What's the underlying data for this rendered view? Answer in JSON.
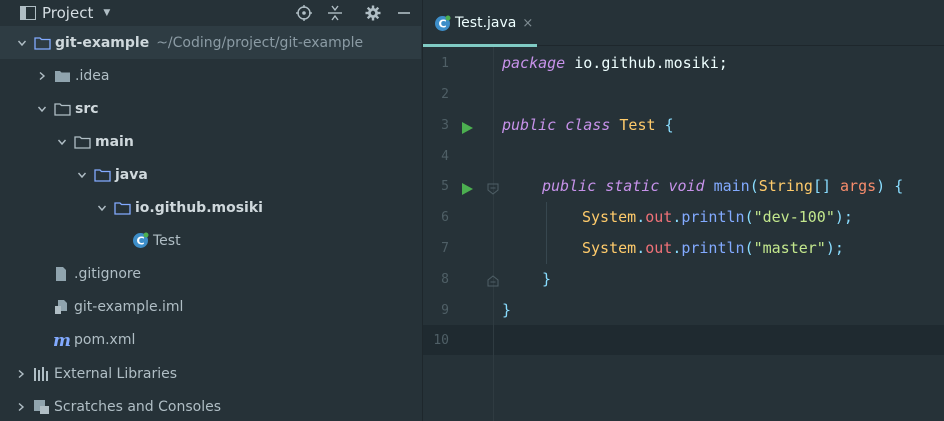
{
  "panel": {
    "title": "Project",
    "tree": [
      {
        "label": "git-example",
        "path": "~/Coding/project/git-example",
        "depth": 0,
        "expanded": true,
        "icon": "folder-icon",
        "bold": true
      },
      {
        "label": ".idea",
        "depth": 1,
        "expanded": false,
        "icon": "folder-filled-icon"
      },
      {
        "label": "src",
        "depth": 1,
        "expanded": true,
        "icon": "folder-icon",
        "bold": true
      },
      {
        "label": "main",
        "depth": 2,
        "expanded": true,
        "icon": "folder-icon",
        "bold": true
      },
      {
        "label": "java",
        "depth": 3,
        "expanded": true,
        "icon": "source-folder-icon",
        "bold": true
      },
      {
        "label": "io.github.mosiki",
        "depth": 4,
        "expanded": true,
        "icon": "package-icon",
        "bold": true
      },
      {
        "label": "Test",
        "depth": 5,
        "icon": "java-class-icon"
      },
      {
        "label": ".gitignore",
        "depth": 1,
        "icon": "file-icon"
      },
      {
        "label": "git-example.iml",
        "depth": 1,
        "icon": "module-file-icon"
      },
      {
        "label": "pom.xml",
        "depth": 1,
        "icon": "maven-icon"
      },
      {
        "label": "External Libraries",
        "depth": 0,
        "expanded": false,
        "icon": "libraries-icon"
      },
      {
        "label": "Scratches and Consoles",
        "depth": 0,
        "expanded": false,
        "icon": "scratches-icon"
      }
    ]
  },
  "editor": {
    "tab_label": "Test.java",
    "tab_close": "×",
    "line_numbers": [
      "1",
      "2",
      "3",
      "4",
      "5",
      "6",
      "7",
      "8",
      "9",
      "10"
    ],
    "current_line": 10
  },
  "colors": {
    "background": "#263238",
    "accent": "#80cbc4",
    "keyword": "#c792ea",
    "class": "#ffcb6b",
    "function": "#82aaff",
    "string": "#c3e88d",
    "field": "#f07178",
    "run_icon": "#4caf50"
  },
  "code": {
    "line1": {
      "kw": "package",
      "rest": " io.github.mosiki;"
    },
    "line3": {
      "kw1": "public",
      "kw2": "class",
      "cls": "Test",
      "brace": "{"
    },
    "line5": {
      "kw1": "public",
      "kw2": "static",
      "kw3": "void",
      "fn": "main",
      "paren_open": "(",
      "type": "String",
      "brackets": "[]",
      "param": "args",
      "paren_close": ")",
      "brace": "{"
    },
    "line6": {
      "obj": "System",
      "dot1": ".",
      "field": "out",
      "dot2": ".",
      "fn": "println",
      "paren_open": "(",
      "str": "\"dev-100\"",
      "end": ");"
    },
    "line7": {
      "obj": "System",
      "dot1": ".",
      "field": "out",
      "dot2": ".",
      "fn": "println",
      "paren_open": "(",
      "str": "\"master\"",
      "end": ");"
    },
    "line8": {
      "brace": "}"
    },
    "line9": {
      "brace": "}"
    }
  }
}
